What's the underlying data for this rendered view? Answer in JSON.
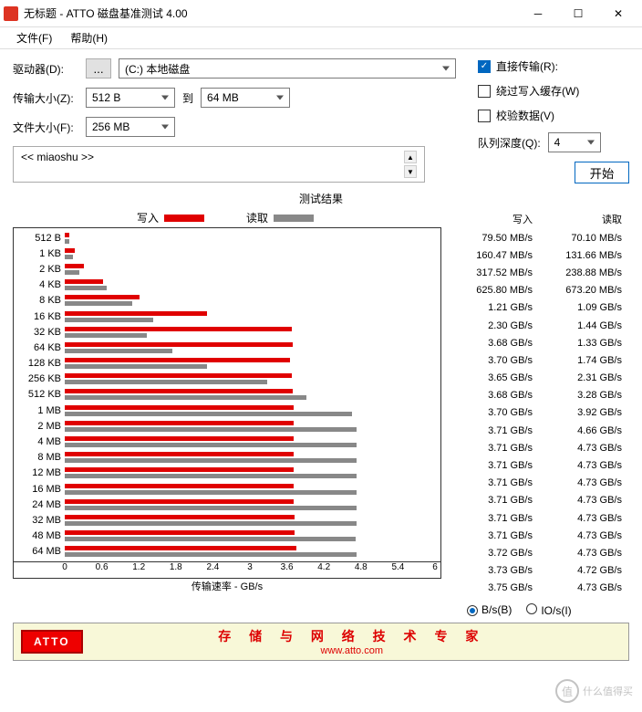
{
  "window": {
    "title": "无标题 - ATTO 磁盘基准测试 4.00"
  },
  "menu": {
    "file": "文件(F)",
    "help": "帮助(H)"
  },
  "form": {
    "drive_label": "驱动器(D):",
    "drive_value": "(C:) 本地磁盘",
    "transfer_label": "传输大小(Z):",
    "transfer_from": "512 B",
    "to_label": "到",
    "transfer_to": "64 MB",
    "file_label": "文件大小(F):",
    "file_value": "256 MB",
    "browse": "..."
  },
  "options": {
    "direct": "直接传输(R):",
    "bypass": "绕过写入缓存(W)",
    "verify": "校验数据(V)",
    "queue_label": "队列深度(Q):",
    "queue_value": "4",
    "start": "开始"
  },
  "desc": {
    "text": "<< miaoshu >>"
  },
  "results": {
    "title": "测试结果",
    "write_label": "写入",
    "read_label": "读取",
    "xlabel": "传输速率 - GB/s",
    "write_header": "写入",
    "read_header": "读取",
    "bs_label": "B/s(B)",
    "io_label": "IO/s(I)"
  },
  "footer": {
    "logo": "ATTO",
    "title": "存 储 与 网 络 技 术 专 家",
    "url": "www.atto.com"
  },
  "watermark": {
    "text": "什么值得买",
    "sym": "值"
  },
  "chart_data": {
    "type": "bar",
    "xlabel": "传输速率 - GB/s",
    "xlim": [
      0,
      6
    ],
    "xticks": [
      0,
      0.6,
      1.2,
      1.8,
      2.4,
      3,
      3.6,
      4.2,
      4.8,
      5.4,
      6
    ],
    "categories": [
      "512 B",
      "1 KB",
      "2 KB",
      "4 KB",
      "8 KB",
      "16 KB",
      "32 KB",
      "64 KB",
      "128 KB",
      "256 KB",
      "512 KB",
      "1 MB",
      "2 MB",
      "4 MB",
      "8 MB",
      "12 MB",
      "16 MB",
      "24 MB",
      "32 MB",
      "48 MB",
      "64 MB"
    ],
    "series": [
      {
        "name": "写入",
        "color": "#e00000",
        "display": [
          "79.50 MB/s",
          "160.47 MB/s",
          "317.52 MB/s",
          "625.80 MB/s",
          "1.21 GB/s",
          "2.30 GB/s",
          "3.68 GB/s",
          "3.70 GB/s",
          "3.65 GB/s",
          "3.68 GB/s",
          "3.70 GB/s",
          "3.71 GB/s",
          "3.71 GB/s",
          "3.71 GB/s",
          "3.71 GB/s",
          "3.71 GB/s",
          "3.71 GB/s",
          "3.71 GB/s",
          "3.72 GB/s",
          "3.73 GB/s",
          "3.75 GB/s"
        ],
        "values": [
          0.0795,
          0.16047,
          0.31752,
          0.6258,
          1.21,
          2.3,
          3.68,
          3.7,
          3.65,
          3.68,
          3.7,
          3.71,
          3.71,
          3.71,
          3.71,
          3.71,
          3.71,
          3.71,
          3.72,
          3.73,
          3.75
        ]
      },
      {
        "name": "读取",
        "color": "#888888",
        "display": [
          "70.10 MB/s",
          "131.66 MB/s",
          "238.88 MB/s",
          "673.20 MB/s",
          "1.09 GB/s",
          "1.44 GB/s",
          "1.33 GB/s",
          "1.74 GB/s",
          "2.31 GB/s",
          "3.28 GB/s",
          "3.92 GB/s",
          "4.66 GB/s",
          "4.73 GB/s",
          "4.73 GB/s",
          "4.73 GB/s",
          "4.73 GB/s",
          "4.73 GB/s",
          "4.73 GB/s",
          "4.73 GB/s",
          "4.72 GB/s",
          "4.73 GB/s"
        ],
        "values": [
          0.0701,
          0.13166,
          0.23888,
          0.6732,
          1.09,
          1.44,
          1.33,
          1.74,
          2.31,
          3.28,
          3.92,
          4.66,
          4.73,
          4.73,
          4.73,
          4.73,
          4.73,
          4.73,
          4.73,
          4.72,
          4.73
        ]
      }
    ]
  }
}
